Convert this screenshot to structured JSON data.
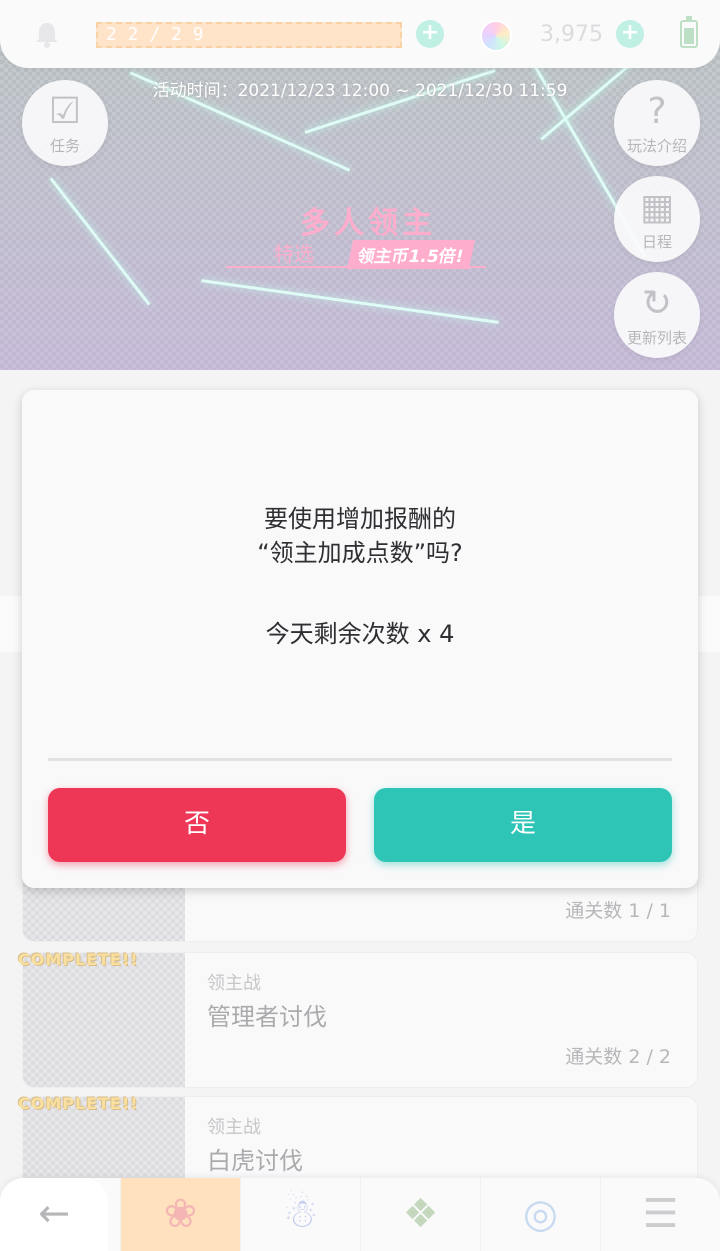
{
  "topbar": {
    "stamina": "2 2 / 2 9",
    "gem_count": "3,975"
  },
  "banner": {
    "event_time": "活动时间：2021/12/23 12:00 ~ 2021/12/30 11:59",
    "title": "多人领主",
    "subtitle": "特选",
    "badge": "领主币1.5倍!",
    "task_label": "任务",
    "help_label": "玩法介绍",
    "schedule_label": "日程",
    "refresh_label": "更新列表"
  },
  "dialog": {
    "line1": "要使用增加报酬的",
    "line2": "“领主加成点数”吗?",
    "remaining": "今天剩余次数 x 4",
    "no_label": "否",
    "yes_label": "是"
  },
  "quests": [
    {
      "clear": "通关数 1 / 1"
    },
    {
      "tag": "COMPLETE!!",
      "type": "领主战",
      "name": "管理者讨伐",
      "clear": "通关数 2 / 2"
    },
    {
      "tag": "COMPLETE!!",
      "type": "领主战",
      "name": "白虎讨伐"
    }
  ],
  "nav": {
    "back_glyph": "←"
  },
  "colors": {
    "no_button": "#ee3656",
    "yes_button": "#2ec5b6",
    "stamina": "#ffc892",
    "event_pink": "#ff5a9a",
    "nav_active": "#ffc27a"
  }
}
